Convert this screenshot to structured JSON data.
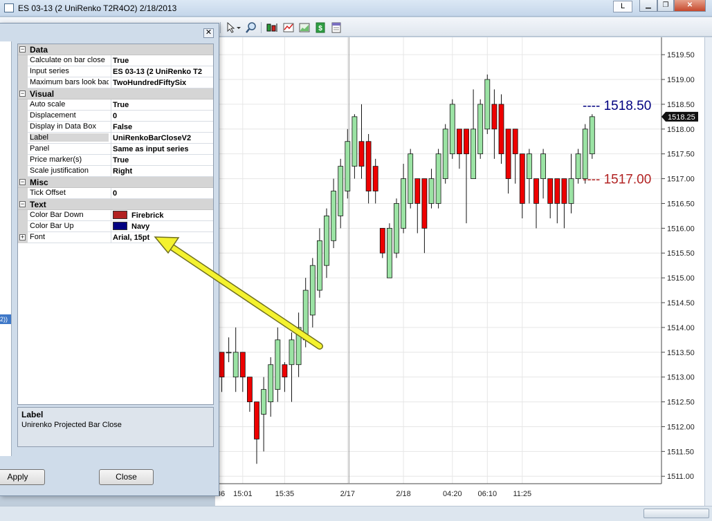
{
  "window": {
    "title": "ES 03-13 (2 UniRenko T2R4O2)  2/18/2013",
    "l_button": "L",
    "minimize": "▁",
    "restore": "❐",
    "close": "✕"
  },
  "toolbar": {
    "icons": [
      "cursor-icon",
      "zoom-icon",
      "bar-type-icon",
      "indicator-icon",
      "chart-style-icon",
      "dollar-icon",
      "strategy-icon"
    ]
  },
  "dialog": {
    "close": "✕",
    "left_item": "2))",
    "categories": [
      {
        "label": "Data",
        "expander": "⊟",
        "properties": [
          {
            "name": "Calculate on bar close",
            "value": "True"
          },
          {
            "name": "Input series",
            "value": "ES 03-13 (2 UniRenko T2"
          },
          {
            "name": "Maximum bars look bac",
            "value": "TwoHundredFiftySix"
          }
        ]
      },
      {
        "label": "Visual",
        "expander": "⊟",
        "properties": [
          {
            "name": "Auto scale",
            "value": "True"
          },
          {
            "name": "Displacement",
            "value": "0"
          },
          {
            "name": "Display in Data Box",
            "value": "False"
          },
          {
            "name": "Label",
            "value": "UniRenkoBarCloseV2"
          },
          {
            "name": "Panel",
            "value": "Same as input series"
          },
          {
            "name": "Price marker(s)",
            "value": "True"
          },
          {
            "name": "Scale justification",
            "value": "Right"
          }
        ]
      },
      {
        "label": "Misc",
        "expander": "⊟",
        "properties": [
          {
            "name": "Tick Offset",
            "value": "0"
          }
        ]
      },
      {
        "label": "Text",
        "expander": "⊟",
        "properties": [
          {
            "name": "Color Bar Down",
            "value": "Firebrick",
            "swatch": "#b22222"
          },
          {
            "name": "Color Bar Up",
            "value": "Navy",
            "swatch": "#000080"
          },
          {
            "name": "Font",
            "value": "Arial, 15pt",
            "expander": "+"
          }
        ]
      }
    ],
    "description": {
      "title": "Label",
      "text": "Unirenko Projected Bar Close"
    },
    "apply_label": "Apply",
    "close_label": "Close"
  },
  "colors": {
    "up_bar": "#9be3a4",
    "down_bar": "#ee0000",
    "up_level": "#000080",
    "down_level": "#b22222",
    "arrow": "#f4f22f"
  },
  "chart_data": {
    "type": "candlestick",
    "ylim": [
      1510.85,
      1519.85
    ],
    "y_ticks": [
      "1519.50",
      "1519.00",
      "1518.50",
      "1518.00",
      "1517.50",
      "1517.00",
      "1516.50",
      "1516.00",
      "1515.50",
      "1515.00",
      "1514.50",
      "1514.00",
      "1513.50",
      "1513.00",
      "1512.50",
      "1512.00",
      "1511.50",
      "1511.00"
    ],
    "x_ticks": [
      {
        "label": "36",
        "index": -1
      },
      {
        "label": "15:01",
        "index": 3
      },
      {
        "label": "15:35",
        "index": 9
      },
      {
        "label": "2/17",
        "index": 18
      },
      {
        "label": "2/18",
        "index": 26
      },
      {
        "label": "04:20",
        "index": 33
      },
      {
        "label": "06:10",
        "index": 38
      },
      {
        "label": "11:25",
        "index": 43
      }
    ],
    "separator_index": 18.2,
    "current_price": "1518.25",
    "projected_up": {
      "label": "---- 1518.50",
      "value": 1518.5
    },
    "projected_down": {
      "label": "---- 1517.00",
      "value": 1517.0
    },
    "bars": [
      {
        "o": 1513.5,
        "c": 1513.0,
        "h": 1513.5,
        "l": 1512.7
      },
      {
        "o": 1513.5,
        "c": 1513.5,
        "h": 1513.8,
        "l": 1513.3
      },
      {
        "o": 1513.0,
        "c": 1513.5,
        "h": 1514.0,
        "l": 1512.7
      },
      {
        "o": 1513.5,
        "c": 1513.0,
        "h": 1513.5,
        "l": 1512.7
      },
      {
        "o": 1513.0,
        "c": 1512.5,
        "h": 1513.0,
        "l": 1512.3
      },
      {
        "o": 1512.5,
        "c": 1511.75,
        "h": 1512.5,
        "l": 1511.25
      },
      {
        "o": 1512.25,
        "c": 1512.75,
        "h": 1513.0,
        "l": 1511.5
      },
      {
        "o": 1512.5,
        "c": 1513.25,
        "h": 1513.4,
        "l": 1512.2
      },
      {
        "o": 1512.75,
        "c": 1513.75,
        "h": 1514.0,
        "l": 1512.5
      },
      {
        "o": 1513.25,
        "c": 1513.0,
        "h": 1513.3,
        "l": 1512.7
      },
      {
        "o": 1513.25,
        "c": 1513.75,
        "h": 1513.9,
        "l": 1512.5
      },
      {
        "o": 1513.25,
        "c": 1514.0,
        "h": 1514.3,
        "l": 1513.0
      },
      {
        "o": 1513.75,
        "c": 1514.75,
        "h": 1515.0,
        "l": 1513.6
      },
      {
        "o": 1514.25,
        "c": 1515.25,
        "h": 1515.4,
        "l": 1514.0
      },
      {
        "o": 1514.75,
        "c": 1515.75,
        "h": 1516.0,
        "l": 1514.6
      },
      {
        "o": 1515.25,
        "c": 1516.25,
        "h": 1516.4,
        "l": 1515.0
      },
      {
        "o": 1515.75,
        "c": 1516.75,
        "h": 1517.0,
        "l": 1515.6
      },
      {
        "o": 1516.25,
        "c": 1517.25,
        "h": 1517.4,
        "l": 1516.0
      },
      {
        "o": 1516.75,
        "c": 1517.75,
        "h": 1518.0,
        "l": 1516.6
      },
      {
        "o": 1517.25,
        "c": 1518.25,
        "h": 1518.3,
        "l": 1517.0
      },
      {
        "o": 1517.75,
        "c": 1517.25,
        "h": 1518.5,
        "l": 1517.0
      },
      {
        "o": 1517.75,
        "c": 1516.75,
        "h": 1517.9,
        "l": 1516.5
      },
      {
        "o": 1517.25,
        "c": 1516.75,
        "h": 1517.4,
        "l": 1516.5
      },
      {
        "o": 1516.0,
        "c": 1515.5,
        "h": 1516.0,
        "l": 1515.4
      },
      {
        "o": 1515.0,
        "c": 1516.0,
        "h": 1516.1,
        "l": 1515.0
      },
      {
        "o": 1515.5,
        "c": 1516.5,
        "h": 1516.6,
        "l": 1515.4
      },
      {
        "o": 1516.0,
        "c": 1517.0,
        "h": 1517.3,
        "l": 1515.9
      },
      {
        "o": 1516.5,
        "c": 1517.5,
        "h": 1517.6,
        "l": 1516.4
      },
      {
        "o": 1517.0,
        "c": 1516.5,
        "h": 1517.0,
        "l": 1515.9
      },
      {
        "o": 1517.0,
        "c": 1516.0,
        "h": 1517.0,
        "l": 1515.5
      },
      {
        "o": 1516.5,
        "c": 1517.0,
        "h": 1517.2,
        "l": 1516.4
      },
      {
        "o": 1516.5,
        "c": 1517.5,
        "h": 1517.6,
        "l": 1516.4
      },
      {
        "o": 1517.0,
        "c": 1518.0,
        "h": 1518.1,
        "l": 1516.9
      },
      {
        "o": 1517.5,
        "c": 1518.5,
        "h": 1518.6,
        "l": 1517.4
      },
      {
        "o": 1518.0,
        "c": 1517.5,
        "h": 1518.0,
        "l": 1517.2
      },
      {
        "o": 1518.0,
        "c": 1517.5,
        "h": 1518.0,
        "l": 1516.1
      },
      {
        "o": 1517.0,
        "c": 1518.0,
        "h": 1518.8,
        "l": 1517.0
      },
      {
        "o": 1517.5,
        "c": 1518.5,
        "h": 1518.6,
        "l": 1517.4
      },
      {
        "o": 1518.0,
        "c": 1519.0,
        "h": 1519.1,
        "l": 1517.9
      },
      {
        "o": 1518.5,
        "c": 1518.0,
        "h": 1518.8,
        "l": 1517.4
      },
      {
        "o": 1518.5,
        "c": 1517.5,
        "h": 1518.7,
        "l": 1517.3
      },
      {
        "o": 1518.0,
        "c": 1517.0,
        "h": 1518.0,
        "l": 1516.7
      },
      {
        "o": 1518.0,
        "c": 1517.5,
        "h": 1518.0,
        "l": 1516.9
      },
      {
        "o": 1517.5,
        "c": 1516.5,
        "h": 1517.5,
        "l": 1516.2
      },
      {
        "o": 1517.0,
        "c": 1517.5,
        "h": 1517.6,
        "l": 1516.5
      },
      {
        "o": 1517.0,
        "c": 1516.5,
        "h": 1517.0,
        "l": 1516.0
      },
      {
        "o": 1517.0,
        "c": 1517.5,
        "h": 1517.6,
        "l": 1516.6
      },
      {
        "o": 1517.0,
        "c": 1516.5,
        "h": 1517.0,
        "l": 1516.2
      },
      {
        "o": 1517.0,
        "c": 1516.5,
        "h": 1517.0,
        "l": 1516.1
      },
      {
        "o": 1517.0,
        "c": 1516.5,
        "h": 1517.0,
        "l": 1516.0
      },
      {
        "o": 1516.5,
        "c": 1517.0,
        "h": 1517.5,
        "l": 1516.3
      },
      {
        "o": 1517.0,
        "c": 1517.5,
        "h": 1517.6,
        "l": 1516.9
      },
      {
        "o": 1517.0,
        "c": 1518.0,
        "h": 1518.1,
        "l": 1516.9
      },
      {
        "o": 1517.5,
        "c": 1518.25,
        "h": 1518.3,
        "l": 1517.4
      }
    ]
  }
}
